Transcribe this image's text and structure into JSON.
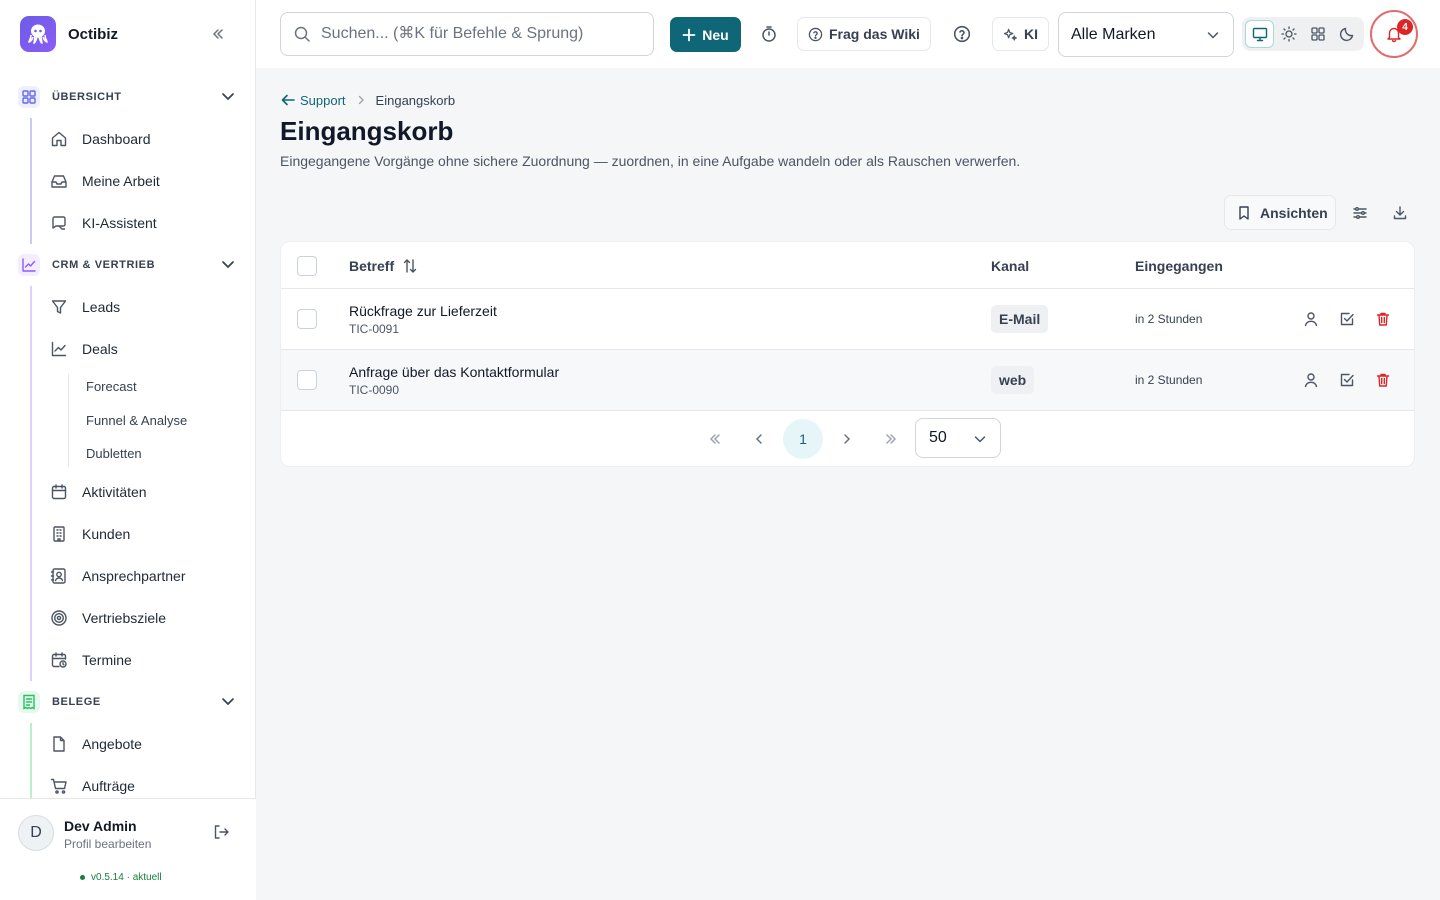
{
  "app": {
    "name": "Octibiz"
  },
  "sidebar": {
    "sections": [
      {
        "label": "ÜBERSICHT",
        "color": "#6366f1",
        "items": [
          "Dashboard",
          "Meine Arbeit",
          "KI-Assistent"
        ]
      },
      {
        "label": "CRM & VERTRIEB",
        "color": "#8b5cf6",
        "items": [
          "Leads",
          "Deals",
          "Aktivitäten",
          "Kunden",
          "Ansprechpartner",
          "Vertriebsziele",
          "Termine"
        ],
        "deal_sub_items": [
          "Forecast",
          "Funnel & Analyse",
          "Dubletten"
        ]
      },
      {
        "label": "BELEGE",
        "color": "#22c55e",
        "items": [
          "Angebote",
          "Aufträge"
        ]
      }
    ],
    "user": {
      "initial": "D",
      "name": "Dev Admin",
      "sub": "Profil bearbeiten"
    },
    "version": "v0.5.14 · aktuell"
  },
  "header": {
    "search_placeholder": "Suchen... (⌘K für Befehle & Sprung)",
    "new_label": "Neu",
    "wiki_label": "Frag das Wiki",
    "ai_label": "KI",
    "brand_select": "Alle Marken",
    "notification_count": "4",
    "accent": "#0f6677"
  },
  "page": {
    "breadcrumb_back": "Support",
    "breadcrumb_current": "Eingangskorb",
    "title": "Eingangskorb",
    "description": "Eingegangene Vorgänge ohne sichere Zuordnung — zuordnen, in eine Aufgabe wandeln oder als Rauschen verwerfen.",
    "views_label": "Ansichten"
  },
  "table": {
    "columns": [
      "Betreff",
      "Kanal",
      "Eingegangen"
    ],
    "rows": [
      {
        "subject": "Rückfrage zur Lieferzeit",
        "ticket": "TIC-0091",
        "channel": "E-Mail",
        "received": "in 2 Stunden"
      },
      {
        "subject": "Anfrage über das Kontaktformular",
        "ticket": "TIC-0090",
        "channel": "web",
        "received": "in 2 Stunden"
      }
    ]
  },
  "pagination": {
    "current_page": "1",
    "page_size": "50"
  }
}
